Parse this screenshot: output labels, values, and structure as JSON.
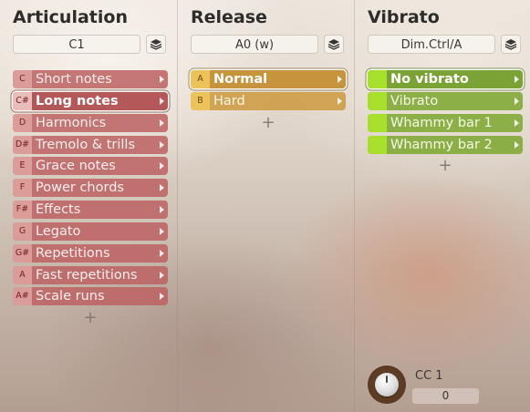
{
  "articulation": {
    "title": "Articulation",
    "key": "C1",
    "items": [
      {
        "key": "C",
        "label": "Short notes"
      },
      {
        "key": "C#",
        "label": "Long notes",
        "selected": true
      },
      {
        "key": "D",
        "label": "Harmonics"
      },
      {
        "key": "D#",
        "label": "Tremolo & trills"
      },
      {
        "key": "E",
        "label": "Grace notes"
      },
      {
        "key": "F",
        "label": "Power chords"
      },
      {
        "key": "F#",
        "label": "Effects"
      },
      {
        "key": "G",
        "label": "Legato"
      },
      {
        "key": "G#",
        "label": "Repetitions"
      },
      {
        "key": "A",
        "label": "Fast repetitions"
      },
      {
        "key": "A#",
        "label": "Scale runs"
      }
    ],
    "add_label": "+"
  },
  "release": {
    "title": "Release",
    "key": "A0 (w)",
    "items": [
      {
        "key": "A",
        "label": "Normal",
        "selected": true
      },
      {
        "key": "B",
        "label": "Hard"
      }
    ],
    "add_label": "+"
  },
  "vibrato": {
    "title": "Vibrato",
    "key": "Dim.Ctrl/A",
    "items": [
      {
        "key": "",
        "label": "No vibrato",
        "selected": true
      },
      {
        "key": "",
        "label": "Vibrato"
      },
      {
        "key": "",
        "label": "Whammy bar 1"
      },
      {
        "key": "",
        "label": "Whammy bar 2"
      }
    ],
    "add_label": "+"
  },
  "controller": {
    "label": "CC 1",
    "value": "0"
  },
  "colors": {
    "articulation": "#bc6262",
    "release": "#ce9c46",
    "vibrato": "#84aa3c",
    "vibrato_key": "#a6e02c"
  },
  "icons": {
    "layer": "layers-icon",
    "arrow": "chevron-right-icon",
    "knob": "knob-icon"
  }
}
